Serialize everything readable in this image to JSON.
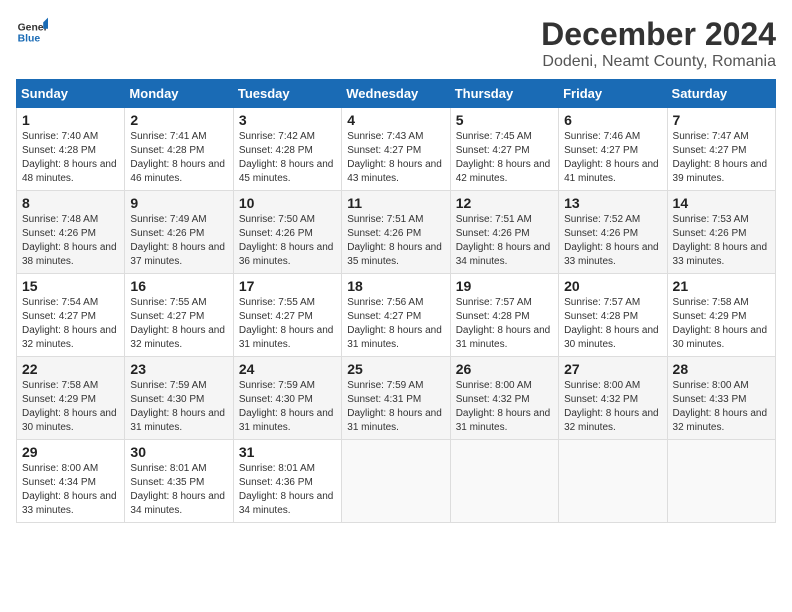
{
  "logo": {
    "line1": "General",
    "line2": "Blue"
  },
  "title": "December 2024",
  "location": "Dodeni, Neamt County, Romania",
  "days_of_week": [
    "Sunday",
    "Monday",
    "Tuesday",
    "Wednesday",
    "Thursday",
    "Friday",
    "Saturday"
  ],
  "weeks": [
    [
      {
        "day": "1",
        "sunrise": "Sunrise: 7:40 AM",
        "sunset": "Sunset: 4:28 PM",
        "daylight": "Daylight: 8 hours and 48 minutes."
      },
      {
        "day": "2",
        "sunrise": "Sunrise: 7:41 AM",
        "sunset": "Sunset: 4:28 PM",
        "daylight": "Daylight: 8 hours and 46 minutes."
      },
      {
        "day": "3",
        "sunrise": "Sunrise: 7:42 AM",
        "sunset": "Sunset: 4:28 PM",
        "daylight": "Daylight: 8 hours and 45 minutes."
      },
      {
        "day": "4",
        "sunrise": "Sunrise: 7:43 AM",
        "sunset": "Sunset: 4:27 PM",
        "daylight": "Daylight: 8 hours and 43 minutes."
      },
      {
        "day": "5",
        "sunrise": "Sunrise: 7:45 AM",
        "sunset": "Sunset: 4:27 PM",
        "daylight": "Daylight: 8 hours and 42 minutes."
      },
      {
        "day": "6",
        "sunrise": "Sunrise: 7:46 AM",
        "sunset": "Sunset: 4:27 PM",
        "daylight": "Daylight: 8 hours and 41 minutes."
      },
      {
        "day": "7",
        "sunrise": "Sunrise: 7:47 AM",
        "sunset": "Sunset: 4:27 PM",
        "daylight": "Daylight: 8 hours and 39 minutes."
      }
    ],
    [
      {
        "day": "8",
        "sunrise": "Sunrise: 7:48 AM",
        "sunset": "Sunset: 4:26 PM",
        "daylight": "Daylight: 8 hours and 38 minutes."
      },
      {
        "day": "9",
        "sunrise": "Sunrise: 7:49 AM",
        "sunset": "Sunset: 4:26 PM",
        "daylight": "Daylight: 8 hours and 37 minutes."
      },
      {
        "day": "10",
        "sunrise": "Sunrise: 7:50 AM",
        "sunset": "Sunset: 4:26 PM",
        "daylight": "Daylight: 8 hours and 36 minutes."
      },
      {
        "day": "11",
        "sunrise": "Sunrise: 7:51 AM",
        "sunset": "Sunset: 4:26 PM",
        "daylight": "Daylight: 8 hours and 35 minutes."
      },
      {
        "day": "12",
        "sunrise": "Sunrise: 7:51 AM",
        "sunset": "Sunset: 4:26 PM",
        "daylight": "Daylight: 8 hours and 34 minutes."
      },
      {
        "day": "13",
        "sunrise": "Sunrise: 7:52 AM",
        "sunset": "Sunset: 4:26 PM",
        "daylight": "Daylight: 8 hours and 33 minutes."
      },
      {
        "day": "14",
        "sunrise": "Sunrise: 7:53 AM",
        "sunset": "Sunset: 4:26 PM",
        "daylight": "Daylight: 8 hours and 33 minutes."
      }
    ],
    [
      {
        "day": "15",
        "sunrise": "Sunrise: 7:54 AM",
        "sunset": "Sunset: 4:27 PM",
        "daylight": "Daylight: 8 hours and 32 minutes."
      },
      {
        "day": "16",
        "sunrise": "Sunrise: 7:55 AM",
        "sunset": "Sunset: 4:27 PM",
        "daylight": "Daylight: 8 hours and 32 minutes."
      },
      {
        "day": "17",
        "sunrise": "Sunrise: 7:55 AM",
        "sunset": "Sunset: 4:27 PM",
        "daylight": "Daylight: 8 hours and 31 minutes."
      },
      {
        "day": "18",
        "sunrise": "Sunrise: 7:56 AM",
        "sunset": "Sunset: 4:27 PM",
        "daylight": "Daylight: 8 hours and 31 minutes."
      },
      {
        "day": "19",
        "sunrise": "Sunrise: 7:57 AM",
        "sunset": "Sunset: 4:28 PM",
        "daylight": "Daylight: 8 hours and 31 minutes."
      },
      {
        "day": "20",
        "sunrise": "Sunrise: 7:57 AM",
        "sunset": "Sunset: 4:28 PM",
        "daylight": "Daylight: 8 hours and 30 minutes."
      },
      {
        "day": "21",
        "sunrise": "Sunrise: 7:58 AM",
        "sunset": "Sunset: 4:29 PM",
        "daylight": "Daylight: 8 hours and 30 minutes."
      }
    ],
    [
      {
        "day": "22",
        "sunrise": "Sunrise: 7:58 AM",
        "sunset": "Sunset: 4:29 PM",
        "daylight": "Daylight: 8 hours and 30 minutes."
      },
      {
        "day": "23",
        "sunrise": "Sunrise: 7:59 AM",
        "sunset": "Sunset: 4:30 PM",
        "daylight": "Daylight: 8 hours and 31 minutes."
      },
      {
        "day": "24",
        "sunrise": "Sunrise: 7:59 AM",
        "sunset": "Sunset: 4:30 PM",
        "daylight": "Daylight: 8 hours and 31 minutes."
      },
      {
        "day": "25",
        "sunrise": "Sunrise: 7:59 AM",
        "sunset": "Sunset: 4:31 PM",
        "daylight": "Daylight: 8 hours and 31 minutes."
      },
      {
        "day": "26",
        "sunrise": "Sunrise: 8:00 AM",
        "sunset": "Sunset: 4:32 PM",
        "daylight": "Daylight: 8 hours and 31 minutes."
      },
      {
        "day": "27",
        "sunrise": "Sunrise: 8:00 AM",
        "sunset": "Sunset: 4:32 PM",
        "daylight": "Daylight: 8 hours and 32 minutes."
      },
      {
        "day": "28",
        "sunrise": "Sunrise: 8:00 AM",
        "sunset": "Sunset: 4:33 PM",
        "daylight": "Daylight: 8 hours and 32 minutes."
      }
    ],
    [
      {
        "day": "29",
        "sunrise": "Sunrise: 8:00 AM",
        "sunset": "Sunset: 4:34 PM",
        "daylight": "Daylight: 8 hours and 33 minutes."
      },
      {
        "day": "30",
        "sunrise": "Sunrise: 8:01 AM",
        "sunset": "Sunset: 4:35 PM",
        "daylight": "Daylight: 8 hours and 34 minutes."
      },
      {
        "day": "31",
        "sunrise": "Sunrise: 8:01 AM",
        "sunset": "Sunset: 4:36 PM",
        "daylight": "Daylight: 8 hours and 34 minutes."
      },
      null,
      null,
      null,
      null
    ]
  ]
}
